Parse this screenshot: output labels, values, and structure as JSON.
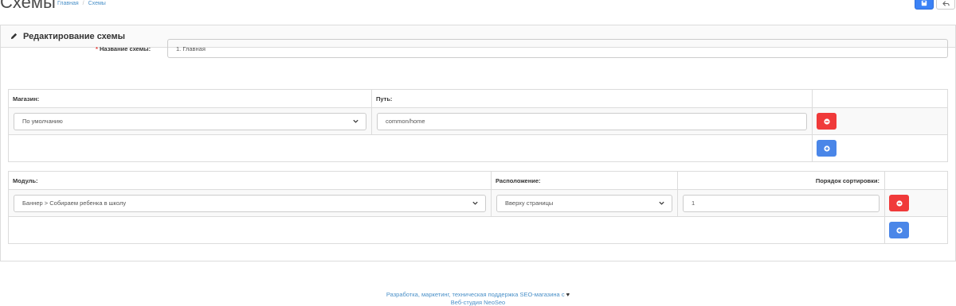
{
  "header": {
    "title": "Схемы",
    "breadcrumb": [
      "Главная",
      "Схемы"
    ]
  },
  "panel": {
    "heading": "Редактирование схемы"
  },
  "form": {
    "name_label": "Название схемы:",
    "name_required_mark": "*",
    "name_value": "1. Главная"
  },
  "routes": {
    "columns": [
      "Магазин:",
      "Путь:"
    ],
    "rows": [
      {
        "store": "По умолчанию",
        "path": "common/home"
      }
    ]
  },
  "modules": {
    "columns": [
      "Модуль:",
      "Расположение:",
      "Порядок сортировки:"
    ],
    "rows": [
      {
        "module": "Баннер > Собираем ребенка в школу",
        "position": "Вверху страницы",
        "sort_order": "1"
      }
    ]
  },
  "footer": {
    "line1": "Разработка, маркетинг, техническая поддержка SEO-магазина с",
    "line2": "Веб-студия NeoSeo"
  },
  "colors": {
    "primary": "#4a86e8",
    "danger": "#f03a3a",
    "link": "#4a90c8"
  }
}
